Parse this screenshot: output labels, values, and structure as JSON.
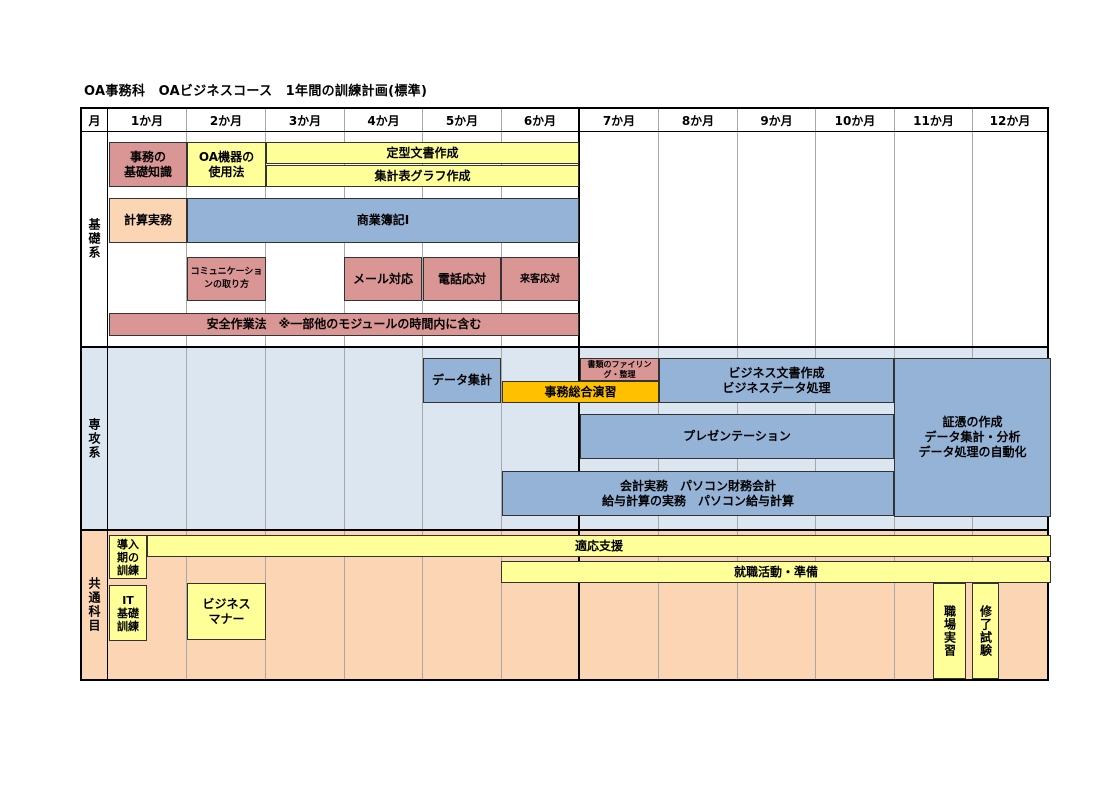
{
  "title": "OA事務科　OAビジネスコース　1年間の訓練計画(標準)",
  "header": {
    "month_label": "月",
    "months": [
      "1か月",
      "2か月",
      "3か月",
      "4か月",
      "5か月",
      "6か月",
      "7か月",
      "8か月",
      "9か月",
      "10か月",
      "11か月",
      "12か月"
    ]
  },
  "sections": {
    "kiso": "基礎系",
    "senko": "専攻系",
    "kyotsu": "共通科目"
  },
  "blocks": {
    "jimu_kiso": "事務の\n基礎知識",
    "oa_kiki": "OA機器の\n使用法",
    "teikei": "定型文書作成",
    "shukei_graph": "集計表グラフ作成",
    "keisan_jitsumu": "計算実務",
    "shogyo_boki": "商業簿記Ⅰ",
    "communication": "コミュニケーショ\nンの取り方",
    "mail": "メール対応",
    "denwa": "電話応対",
    "raikyaku": "来客応対",
    "anzen": "安全作業法　※一部他のモジュールの時間内に含む",
    "data_shukei": "データ集計",
    "shorui_filing": "書類のファイリン\nグ・整理",
    "jimu_sogo": "事務総合演習",
    "business_bunsho": "ビジネス文書作成\nビジネスデータ処理",
    "shohyo": "証憑の作成\nデータ集計・分析\nデータ処理の自動化",
    "presentation": "プレゼンテーション",
    "kaikei": "会計実務　パソコン財務会計\n給与計算の実務　パソコン給与計算",
    "donyuki": "導入\n期の\n訓練",
    "tekio": "適応支援",
    "shushoku": "就職活動・準備",
    "it_kiso": "IT\n基礎\n訓練",
    "business_manner": "ビジネス\nマナー",
    "shokuba": "職場実習",
    "shuryo": "修了試験"
  },
  "colors": {
    "yellow": "#ffff99",
    "blue": "#95b3d7",
    "red": "#da9694",
    "peach": "#fcd5b4",
    "light_blue": "#dce6f1",
    "orange": "#ffc000"
  }
}
